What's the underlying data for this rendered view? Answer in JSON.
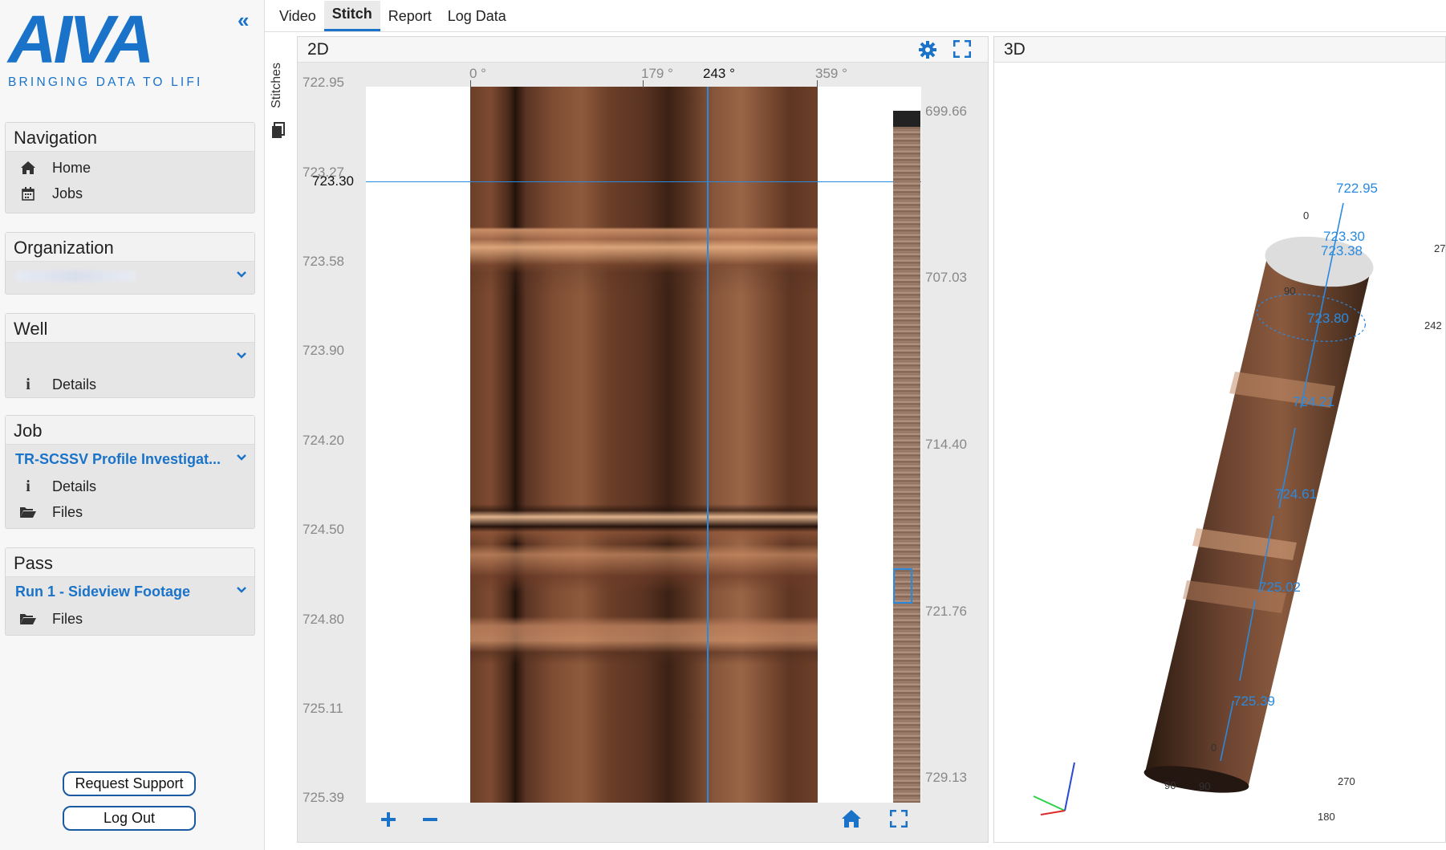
{
  "logo": {
    "text": "AIVA",
    "tagline": "BRINGING DATA TO LIFE"
  },
  "sidebar": {
    "collapse": "«",
    "navigation": {
      "title": "Navigation",
      "items": [
        {
          "label": "Home",
          "icon": "home-icon"
        },
        {
          "label": "Jobs",
          "icon": "calendar-icon"
        }
      ]
    },
    "organization": {
      "title": "Organization",
      "value": ""
    },
    "well": {
      "title": "Well",
      "value": "",
      "details": "Details"
    },
    "job": {
      "title": "Job",
      "value": "TR-SCSSV Profile Investigat...",
      "details": "Details",
      "files": "Files"
    },
    "pass": {
      "title": "Pass",
      "value": "Run 1 - Sideview Footage",
      "files": "Files"
    },
    "request_support": "Request Support",
    "logout": "Log Out"
  },
  "tabs": [
    {
      "label": "Video"
    },
    {
      "label": "Stitch",
      "active": true
    },
    {
      "label": "Report"
    },
    {
      "label": "Log Data"
    }
  ],
  "stitches_label": "Stitches",
  "view2d": {
    "title": "2D",
    "depth_labels": [
      "722.95",
      "723.27",
      "723.58",
      "723.90",
      "724.20",
      "724.50",
      "724.80",
      "725.11",
      "725.39"
    ],
    "current_depth": "723.30",
    "angle_labels": [
      "0 °",
      "179 °",
      "243 °",
      "359 °"
    ],
    "overview_labels": [
      "699.66",
      "707.03",
      "714.40",
      "721.76",
      "729.13"
    ]
  },
  "view3d": {
    "title": "3D",
    "depth_labels": [
      "722.95",
      "723.30",
      "723.38",
      "723.80",
      "724.21",
      "724.61",
      "725.02",
      "725.39"
    ],
    "angle_labels": [
      "0",
      "27",
      "90",
      "242",
      "90",
      "0",
      "90",
      "270",
      "180"
    ]
  },
  "colors": {
    "accent": "#1a73c8",
    "line": "#2a8ae0",
    "depth_text": "#2a8ae0"
  }
}
